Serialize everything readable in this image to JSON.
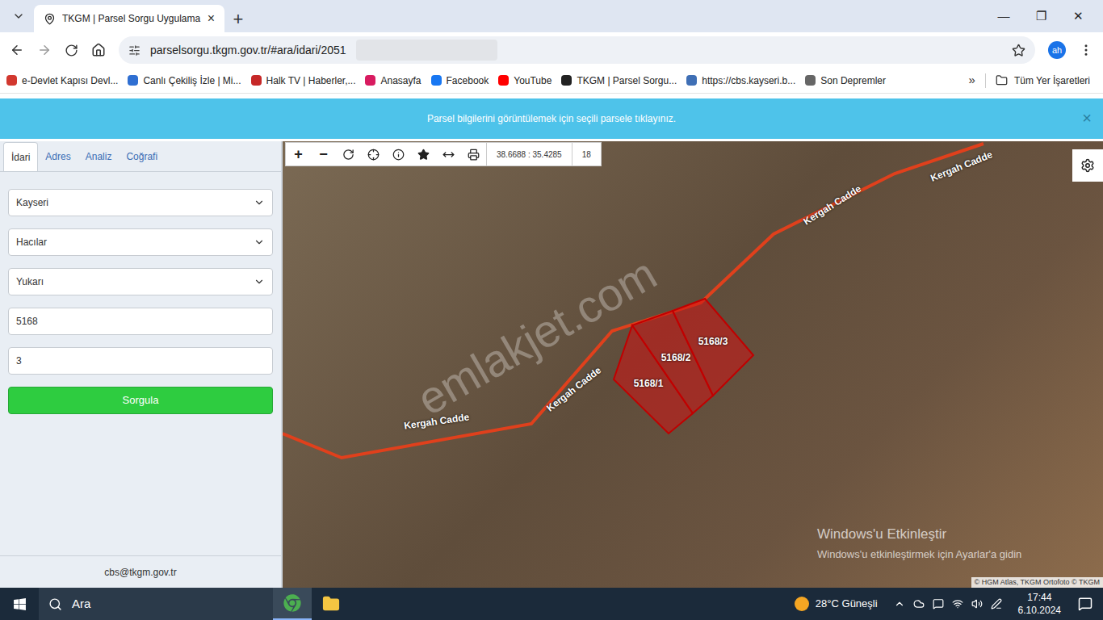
{
  "browser": {
    "tab_title": "TKGM | Parsel Sorgu Uygulama",
    "tab_close": "×",
    "new_tab": "+",
    "window_controls": [
      "—",
      "❐",
      "✕"
    ],
    "url": "parselsorgu.tkgm.gov.tr/#ara/idari/2051",
    "profile": "ah",
    "bookmarks": [
      {
        "label": "e-Devlet Kapısı Devl...",
        "color": "#d2382f"
      },
      {
        "label": "Canlı Çekiliş İzle | Mi...",
        "color": "#2f6fd2"
      },
      {
        "label": "Halk TV | Haberler,...",
        "color": "#c62828"
      },
      {
        "label": "Anasayfa",
        "color": "#d81b60"
      },
      {
        "label": "Facebook",
        "color": "#1877f2"
      },
      {
        "label": "YouTube",
        "color": "#ff0000"
      },
      {
        "label": "TKGM | Parsel Sorgu...",
        "color": "#222222"
      },
      {
        "label": "https://cbs.kayseri.b...",
        "color": "#3f6fb5"
      },
      {
        "label": "Son Depremler",
        "color": "#666666"
      }
    ],
    "bookmarks_more": "»",
    "all_bookmarks": "Tüm Yer İşaretleri"
  },
  "banner": {
    "text": "Parsel bilgilerini görüntülemek için seçili parsele tıklayınız.",
    "close": "×"
  },
  "sidebar": {
    "tabs": [
      {
        "label": "İdari",
        "selected": true
      },
      {
        "label": "Adres",
        "selected": false
      },
      {
        "label": "Analiz",
        "selected": false
      },
      {
        "label": "Coğrafi",
        "selected": false
      }
    ],
    "selects": [
      "Kayseri",
      "Hacılar",
      "Yukarı"
    ],
    "inputs": [
      "5168",
      "3"
    ],
    "button": "Sorgula",
    "footer": "cbs@tkgm.gov.tr"
  },
  "map": {
    "toolbar": [
      "+",
      "−"
    ],
    "coordinates": "38.6688 : 35.4285",
    "zoom": "18",
    "streets": [
      "Kergah Cadde",
      "Kergah Cadde",
      "Kergah Cadde",
      "Kergah Cadde"
    ],
    "parcels": [
      {
        "label": "5168/1"
      },
      {
        "label": "5168/2"
      },
      {
        "label": "5168/3"
      }
    ],
    "watermark": "emlakjet.com",
    "activation": {
      "title": "Windows'u Etkinleştir",
      "subtitle": "Windows'u etkinleştirmek için Ayarlar'a gidin"
    },
    "attribution": "© HGM Atlas, TKGM Ortofoto © TKGM"
  },
  "taskbar": {
    "search": "Ara",
    "weather": "28°C Güneşli",
    "time": "17:44",
    "date": "6.10.2024"
  }
}
